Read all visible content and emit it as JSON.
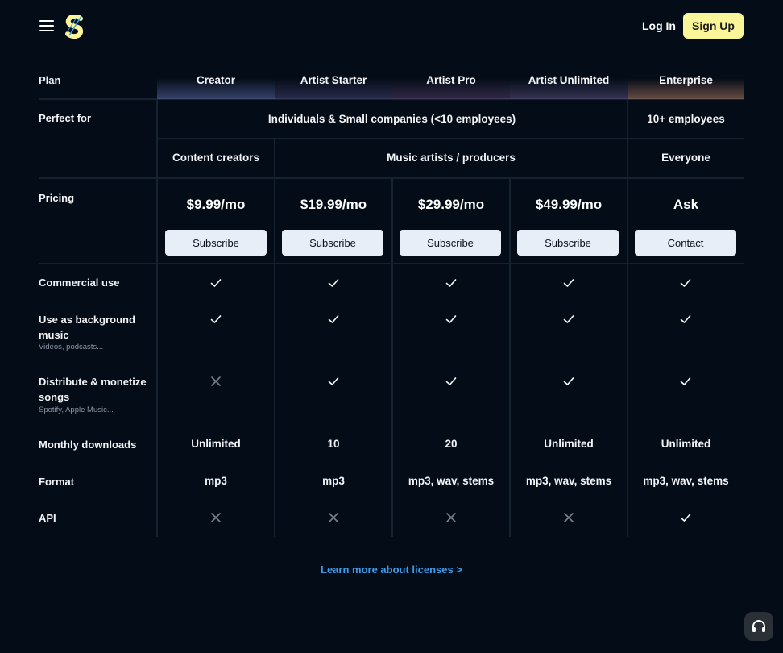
{
  "header": {
    "menu_icon": "hamburger-menu-icon",
    "logo_icon": "s-logo-icon",
    "login_label": "Log In",
    "signup_label": "Sign Up",
    "accent": "#fbf59a"
  },
  "table": {
    "plan_label": "Plan",
    "plans": [
      "Creator",
      "Artist Starter",
      "Artist Pro",
      "Artist Unlimited",
      "Enterprise"
    ],
    "perfect_for_label": "Perfect for",
    "perfect_for_top": [
      "Individuals & Small companies (<10 employees)",
      "10+ employees"
    ],
    "perfect_for_bottom": [
      "Content creators",
      "Music artists / producers",
      "Everyone"
    ],
    "pricing_label": "Pricing",
    "prices": [
      "$9.99/mo",
      "$19.99/mo",
      "$29.99/mo",
      "$49.99/mo",
      "Ask"
    ],
    "actions": [
      "Subscribe",
      "Subscribe",
      "Subscribe",
      "Subscribe",
      "Contact"
    ],
    "features": [
      {
        "label": "Commercial use",
        "sublabel": "",
        "values": [
          "check",
          "check",
          "check",
          "check",
          "check"
        ]
      },
      {
        "label": "Use as background music",
        "sublabel": "Videos, podcasts...",
        "values": [
          "check",
          "check",
          "check",
          "check",
          "check"
        ]
      },
      {
        "label": "Distribute & monetize songs",
        "sublabel": "Spotify, Apple Music...",
        "values": [
          "cross",
          "check",
          "check",
          "check",
          "check"
        ]
      },
      {
        "label": "Monthly downloads",
        "sublabel": "",
        "values": [
          "Unlimited",
          "10",
          "20",
          "Unlimited",
          "Unlimited"
        ]
      },
      {
        "label": "Format",
        "sublabel": "",
        "values": [
          "mp3",
          "mp3",
          "mp3, wav, stems",
          "mp3, wav, stems",
          "mp3, wav, stems"
        ]
      },
      {
        "label": "API",
        "sublabel": "",
        "values": [
          "cross",
          "cross",
          "cross",
          "cross",
          "check"
        ]
      }
    ]
  },
  "footer": {
    "learn_more": "Learn more about licenses >",
    "support_icon": "headphones-support-icon",
    "link_color": "#3e9be7"
  }
}
